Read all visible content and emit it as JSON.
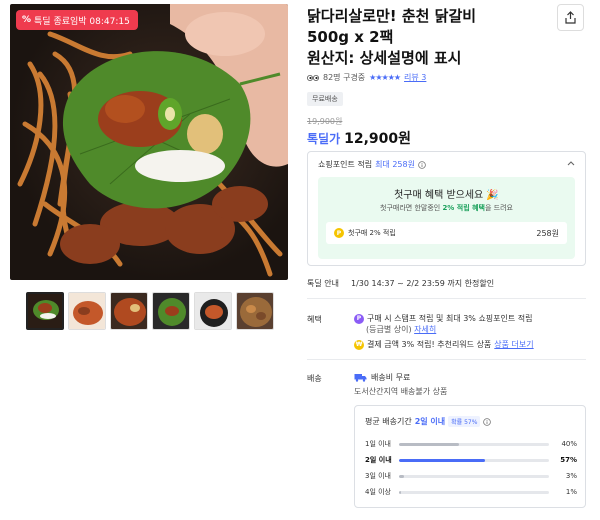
{
  "product": {
    "title_lines": [
      "닭다리살로만! 춘천 닭갈비",
      "500g x 2팩",
      "원산지: 상세설명에 표시"
    ],
    "sale_badge": "특딜 종료임박 08:47:15",
    "viewers": "82명 구경중",
    "stars": "★★★★★",
    "review_link": "리뷰 3",
    "shipping_chip": "무료배송",
    "original_price": "19,900원",
    "price_label": "톡딜가",
    "price": "12,900원"
  },
  "points": {
    "header_prefix": "쇼핑포인트 적립",
    "header_max": "최대 258원",
    "first_title": "첫구매 혜택 받으세요 🎉",
    "first_sub_prefix": "첫구매라면 한말중인",
    "first_sub_hl": "2% 적립 혜택",
    "first_sub_suffix": "을 드려요",
    "row_label": "첫구매 2% 적립",
    "row_amount": "258원"
  },
  "sale_info": {
    "label": "톡딜 안내",
    "period": "1/30 14:37 ~ 2/2 23:59 까지 한정할인"
  },
  "benefits": {
    "label": "혜택",
    "line1": "구매 시 스탬프 적립 및 최대 3% 쇼핑포인트 적립",
    "line1_sub_prefix": "(등급별 상이)",
    "line1_link": "자세히",
    "line2": "결제 금액 3% 적립! 추천리워드 상품",
    "line2_link": "상품 더보기"
  },
  "shipping": {
    "label": "배송",
    "line1": "배송비 무료",
    "line2": "도서산간지역 배송불가 상품",
    "delivery_prefix": "평균 배송기간",
    "delivery_days": "2일 이내",
    "delivery_chip": "확률 57%",
    "rows": [
      {
        "label": "1일 이내",
        "value": "40%",
        "pct": 40
      },
      {
        "label": "2일 이내",
        "value": "57%",
        "pct": 57
      },
      {
        "label": "3일 이내",
        "value": "3%",
        "pct": 3
      },
      {
        "label": "4일 이상",
        "value": "1%",
        "pct": 1
      }
    ]
  },
  "thumb_count": 6,
  "colors": {
    "accent": "#4a6cf7",
    "sale_red": "#ef3b4e",
    "green": "#1aa05b"
  }
}
